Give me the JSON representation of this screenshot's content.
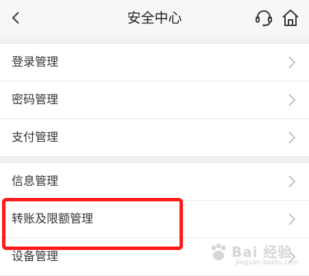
{
  "header": {
    "title": "安全中心",
    "back_icon": "chevron-left-icon",
    "support_icon": "headset-icon",
    "home_icon": "home-icon"
  },
  "groups": [
    {
      "items": [
        {
          "label": "登录管理"
        },
        {
          "label": "密码管理"
        },
        {
          "label": "支付管理"
        }
      ]
    },
    {
      "items": [
        {
          "label": "信息管理"
        },
        {
          "label": "转账及限额管理"
        },
        {
          "label": "设备管理"
        }
      ]
    }
  ],
  "annotation": {
    "color": "#ff1a1a"
  },
  "watermark": {
    "brand": "Bai 经验",
    "url": "jingyan.baidu.com"
  },
  "colors": {
    "background": "#f2f2f2",
    "card": "#ffffff",
    "text": "#333333"
  }
}
